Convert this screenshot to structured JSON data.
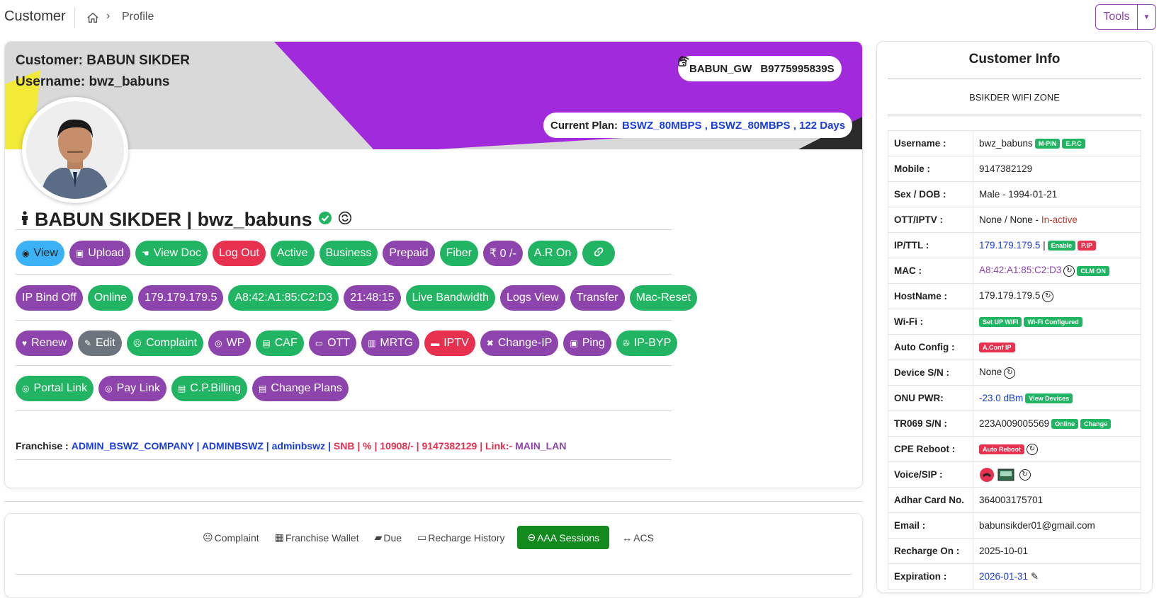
{
  "topbar": {
    "title": "Customer",
    "crumb": "Profile",
    "tools_label": "Tools"
  },
  "banner": {
    "customer": "Customer: BABUN SIKDER",
    "username": "Username: bwz_babuns",
    "gateway": "BABUN_GW",
    "device_id": "B9775995839S",
    "plan_label": "Current Plan:",
    "plan_value": "BSWZ_80MBPS , BSWZ_80MBPS , 122 Days"
  },
  "profile": {
    "name": "BABUN SIKDER | bwz_babuns"
  },
  "buttons_row1": [
    "View",
    "Upload",
    "View Doc",
    "Log Out",
    "Active",
    "Business",
    "Prepaid",
    "Fiber",
    "₹ 0 /-",
    "A.R On",
    ""
  ],
  "buttons_row2": [
    "IP Bind Off",
    "Online",
    "179.179.179.5",
    "A8:42:A1:85:C2:D3",
    "21:48:15",
    "Live Bandwidth",
    "Logs View",
    "Transfer",
    "Mac-Reset"
  ],
  "buttons_row3": [
    "Renew",
    "Edit",
    "Complaint",
    "WP",
    "CAF",
    "OTT",
    "MRTG",
    "IPTV",
    "Change-IP",
    "Ping",
    "IP-BYP"
  ],
  "buttons_row4": [
    "Portal Link",
    "Pay Link",
    "C.P.Billing",
    "Change Plans"
  ],
  "franchise": {
    "label": "Franchise :",
    "company": "ADMIN_BSWZ_COMPANY | ADMINBSWZ | adminbswz |",
    "details": "SNB | % | 10908/- | 9147382129 | Link:-",
    "link": "MAIN_LAN"
  },
  "tabs": [
    "Complaint",
    "Franchise Wallet",
    "Due",
    "Recharge History",
    "AAA Sessions",
    "ACS"
  ],
  "customer_info": {
    "title": "Customer Info",
    "zone": "BSIKDER WIFI ZONE",
    "rows": {
      "username_k": "Username :",
      "username_v": "bwz_babuns",
      "mpin": "M-PIN",
      "epc": "E.P.C",
      "mobile_k": "Mobile :",
      "mobile_v": "9147382129",
      "sex_k": "Sex / DOB :",
      "sex_v": "Male - 1994-01-21",
      "ott_k": "OTT/IPTV :",
      "ott_v": "None / None -",
      "ott_status": "In-active",
      "ip_k": "IP/TTL :",
      "ip_v": "179.179.179.5",
      "ip_sep": "|",
      "enable": "Enable",
      "pip": "P.IP",
      "mac_k": "MAC :",
      "mac_v": "A8:42:A1:85:C2:D3",
      "clm": "CLM ON",
      "host_k": "HostName :",
      "host_v": "179.179.179.5",
      "wifi_k": "Wi-Fi :",
      "wifi_setup": "Set UP WIFI",
      "wifi_conf": "Wi-Fi Configured",
      "auto_k": "Auto Config :",
      "auto_v": "A.Conf IP",
      "dev_k": "Device S/N :",
      "dev_v": "None",
      "onu_k": "ONU PWR:",
      "onu_v": "-23.0 dBm",
      "view_dev": "View Devices",
      "tr_k": "TR069 S/N :",
      "tr_v": "223A009005569",
      "tr_online": "Online",
      "tr_change": "Change",
      "cpe_k": "CPE Reboot :",
      "cpe_v": "Auto Reboot",
      "voice_k": "Voice/SIP :",
      "adhar_k": "Adhar Card No.",
      "adhar_v": "364003175701",
      "email_k": "Email :",
      "email_v": "babunsikder01@gmail.com",
      "rech_k": "Recharge On :",
      "rech_v": "2025-10-01",
      "exp_k": "Expiration :",
      "exp_v": "2026-01-31"
    }
  },
  "colors": {
    "green": "#21b462",
    "purple": "#8e44ad",
    "red": "#e8304f",
    "blue": "#3bb2f5",
    "link_blue": "#1a3ddb",
    "tab_active": "#138a1d"
  }
}
